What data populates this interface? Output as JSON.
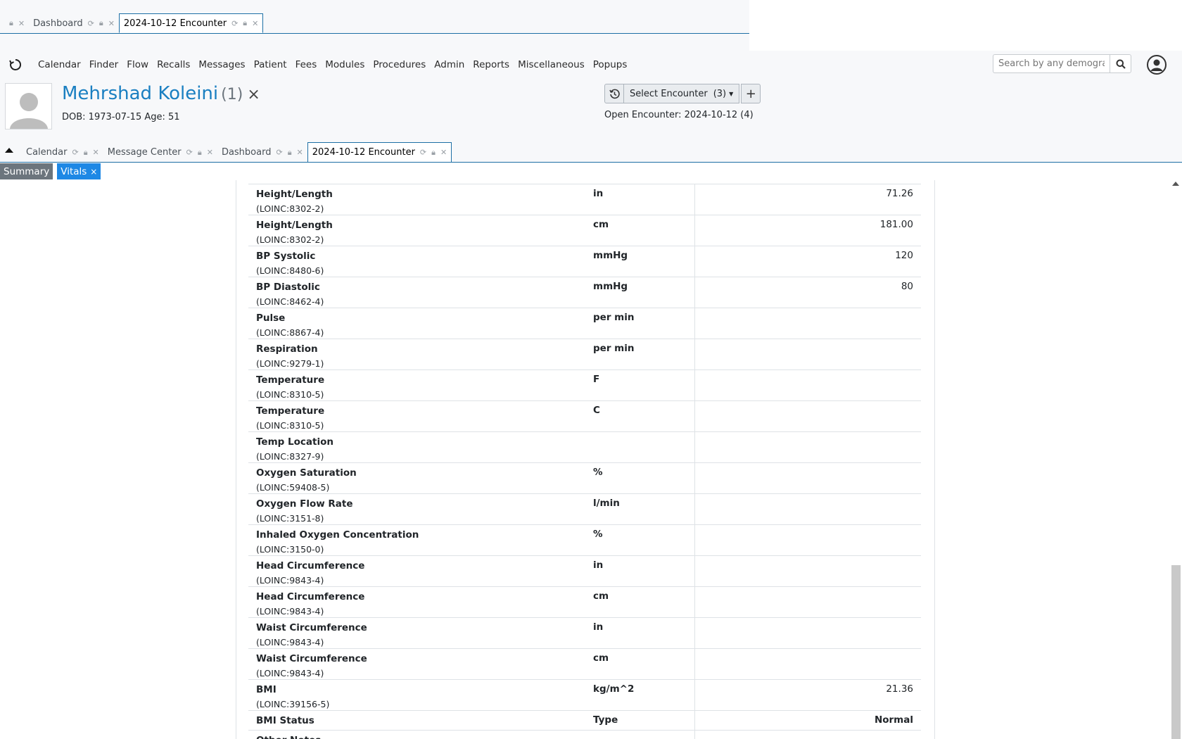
{
  "top_tabs": [
    {
      "label": "Dashboard",
      "active": false
    },
    {
      "label": "2024-10-12 Encounter",
      "active": true
    }
  ],
  "nav": {
    "menu": [
      "Calendar",
      "Finder",
      "Flow",
      "Recalls",
      "Messages",
      "Patient",
      "Fees",
      "Modules",
      "Procedures",
      "Admin",
      "Reports",
      "Miscellaneous",
      "Popups"
    ],
    "search_placeholder": "Search by any demographics"
  },
  "patient": {
    "name": "Mehrshad Koleini",
    "pid": "(1)",
    "close": "×",
    "dob_line": "DOB: 1973-07-15 Age: 51"
  },
  "encounter": {
    "select_label": "Select Encounter",
    "count": "(3)",
    "add": "+",
    "open_label": "Open Encounter:",
    "open_value": "2024-10-12 (4)"
  },
  "tabs2": [
    {
      "label": "Calendar",
      "active": false
    },
    {
      "label": "Message Center",
      "active": false
    },
    {
      "label": "Dashboard",
      "active": false
    },
    {
      "label": "2024-10-12 Encounter",
      "active": true
    }
  ],
  "subtabs": {
    "summary": "Summary",
    "vitals": "Vitals",
    "vitals_close": "×"
  },
  "vitals": [
    {
      "name": "Height/Length",
      "code": "(LOINC:8302-2)",
      "unit": "in",
      "value": "71.26"
    },
    {
      "name": "Height/Length",
      "code": "(LOINC:8302-2)",
      "unit": "cm",
      "value": "181.00"
    },
    {
      "name": "BP Systolic",
      "code": "(LOINC:8480-6)",
      "unit": "mmHg",
      "value": "120"
    },
    {
      "name": "BP Diastolic",
      "code": "(LOINC:8462-4)",
      "unit": "mmHg",
      "value": "80"
    },
    {
      "name": "Pulse",
      "code": "(LOINC:8867-4)",
      "unit": "per min",
      "value": ""
    },
    {
      "name": "Respiration",
      "code": "(LOINC:9279-1)",
      "unit": "per min",
      "value": ""
    },
    {
      "name": "Temperature",
      "code": "(LOINC:8310-5)",
      "unit": "F",
      "value": ""
    },
    {
      "name": "Temperature",
      "code": "(LOINC:8310-5)",
      "unit": "C",
      "value": ""
    },
    {
      "name": "Temp Location",
      "code": "(LOINC:8327-9)",
      "unit": "",
      "value": ""
    },
    {
      "name": "Oxygen Saturation",
      "code": "(LOINC:59408-5)",
      "unit": "%",
      "value": ""
    },
    {
      "name": "Oxygen Flow Rate",
      "code": "(LOINC:3151-8)",
      "unit": "l/min",
      "value": ""
    },
    {
      "name": "Inhaled Oxygen Concentration",
      "code": "(LOINC:3150-0)",
      "unit": "%",
      "value": ""
    },
    {
      "name": "Head Circumference",
      "code": "(LOINC:9843-4)",
      "unit": "in",
      "value": ""
    },
    {
      "name": "Head Circumference",
      "code": "(LOINC:9843-4)",
      "unit": "cm",
      "value": ""
    },
    {
      "name": "Waist Circumference",
      "code": "(LOINC:9843-4)",
      "unit": "in",
      "value": ""
    },
    {
      "name": "Waist Circumference",
      "code": "(LOINC:9843-4)",
      "unit": "cm",
      "value": ""
    },
    {
      "name": "BMI",
      "code": "(LOINC:39156-5)",
      "unit": "kg/m^2",
      "value": "21.36"
    }
  ],
  "bmi_status": {
    "name": "BMI Status",
    "unit": "Type",
    "value": "Normal"
  },
  "other_notes": "Other Notes"
}
